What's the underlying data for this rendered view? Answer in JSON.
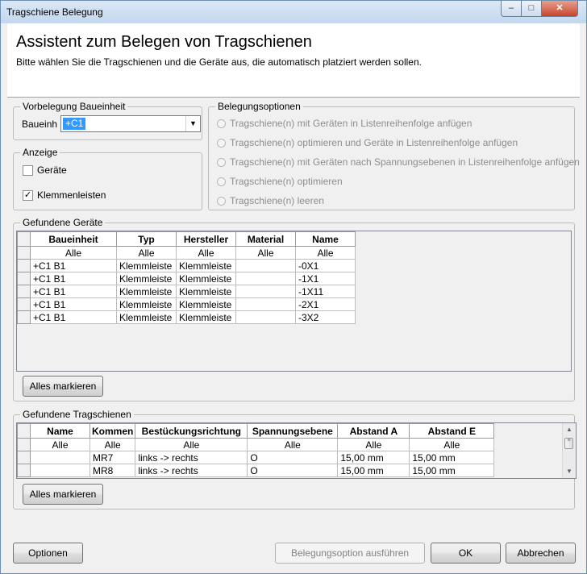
{
  "window": {
    "title": "Tragschiene Belegung"
  },
  "header": {
    "title": "Assistent zum Belegen von Tragschienen",
    "subtitle": "Bitte wählen Sie die Tragschienen und die Geräte aus, die automatisch platziert werden sollen."
  },
  "vorbelegung": {
    "legend": "Vorbelegung Baueinheit",
    "label": "Baueinh",
    "value": "+C1"
  },
  "anzeige": {
    "legend": "Anzeige",
    "geraete": {
      "label": "Geräte",
      "checked": false
    },
    "klemmen": {
      "label": "Klemmenleisten",
      "checked": true,
      "mark": "✓"
    }
  },
  "belegungsoptionen": {
    "legend": "Belegungsoptionen",
    "options": [
      "Tragschiene(n) mit Geräten in Listenreihenfolge anfügen",
      "Tragschiene(n) optimieren und Geräte in Listenreihenfolge anfügen",
      "Tragschiene(n) mit Geräten nach Spannungsebenen in Listenreihenfolge anfügen",
      "Tragschiene(n) optimieren",
      "Tragschiene(n) leeren"
    ]
  },
  "geraete_grid": {
    "legend": "Gefundene Geräte",
    "columns": [
      "Baueinheit",
      "Typ",
      "Hersteller",
      "Material",
      "Name"
    ],
    "filter": [
      "Alle",
      "Alle",
      "Alle",
      "Alle",
      "Alle"
    ],
    "rows": [
      [
        "+C1 B1",
        "Klemmleiste",
        "Klemmleiste",
        "",
        "-0X1"
      ],
      [
        "+C1 B1",
        "Klemmleiste",
        "Klemmleiste",
        "",
        "-1X1"
      ],
      [
        "+C1 B1",
        "Klemmleiste",
        "Klemmleiste",
        "",
        "-1X11"
      ],
      [
        "+C1 B1",
        "Klemmleiste",
        "Klemmleiste",
        "",
        "-2X1"
      ],
      [
        "+C1 B1",
        "Klemmleiste",
        "Klemmleiste",
        "",
        "-3X2"
      ]
    ],
    "button": "Alles markieren"
  },
  "schienen_grid": {
    "legend": "Gefundene Tragschienen",
    "columns": [
      "Name",
      "Kommen",
      "Bestückungsrichtung",
      "Spannungsebene",
      "Abstand A",
      "Abstand E"
    ],
    "filter": [
      "Alle",
      "Alle",
      "Alle",
      "Alle",
      "Alle",
      "Alle"
    ],
    "rows": [
      [
        "",
        "MR7",
        "links -> rechts",
        "O",
        "15,00 mm",
        "15,00 mm"
      ],
      [
        "",
        "MR8",
        "links -> rechts",
        "O",
        "15,00 mm",
        "15,00 mm"
      ]
    ],
    "button": "Alles markieren",
    "scroll_up": "▲",
    "scroll_down": "▼",
    "scroll_thumb": "≡"
  },
  "footer": {
    "optionen": "Optionen",
    "ausfuehren": "Belegungsoption ausführen",
    "ok": "OK",
    "abbrechen": "Abbrechen"
  },
  "icons": {
    "dropdown": "▼",
    "minimize": "–",
    "maximize": "□",
    "close": "✕"
  },
  "colors": {
    "selection": "#3399ff",
    "disabled_text": "#8d8d8d"
  }
}
